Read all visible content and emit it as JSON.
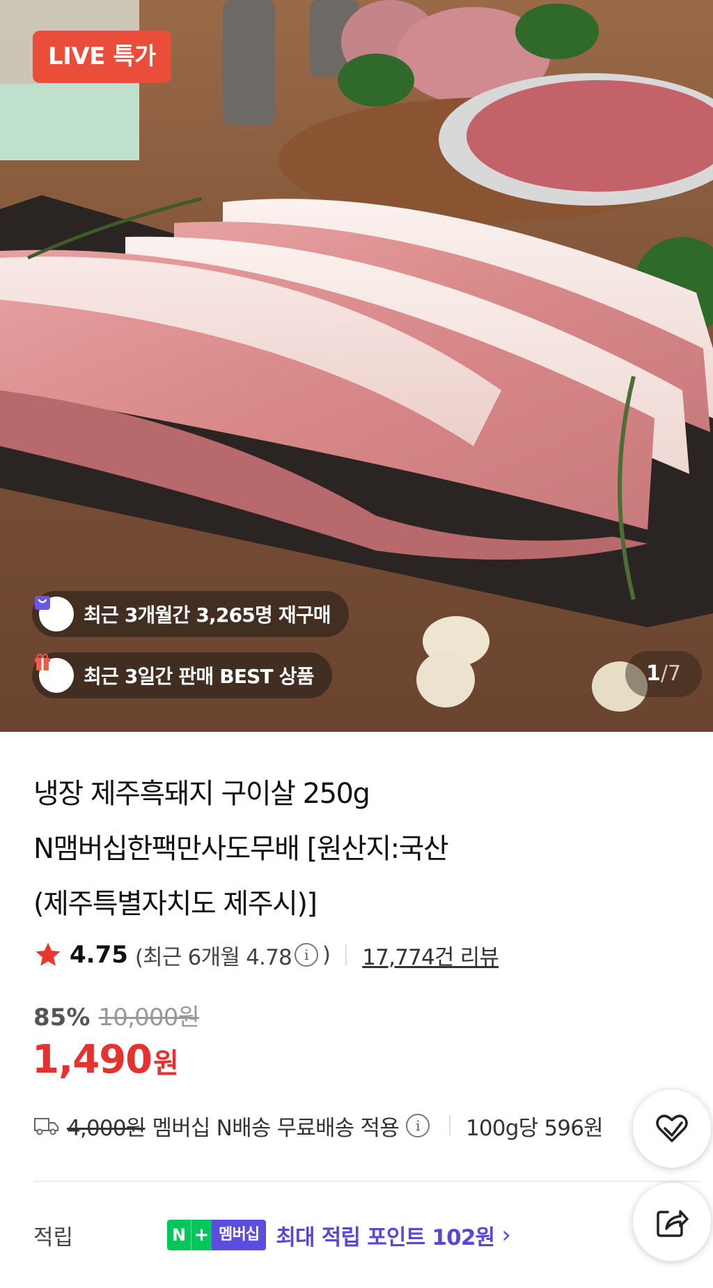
{
  "hero": {
    "live_badge": "LIVE 특가",
    "chips": [
      {
        "icon": "shopping-bag-icon",
        "text": "최근 3개월간 3,265명 재구매"
      },
      {
        "icon": "gift-box-icon",
        "text": "최근 3일간 판매 BEST 상품"
      }
    ],
    "pager": {
      "current": "1",
      "separator": "/",
      "total": "7"
    }
  },
  "product": {
    "title_lines": [
      "냉장 제주흑돼지 구이살 250g",
      "N맴버십한팩만사도무배 [원산지:국산",
      "(제주특별자치도 제주시)]"
    ]
  },
  "rating": {
    "score": "4.75",
    "recent_prefix": "(최근 6개월 4.78",
    "recent_suffix": ")",
    "info_glyph": "i",
    "reviews": "17,774건 리뷰"
  },
  "price": {
    "discount_rate": "85%",
    "original": "10,000원",
    "sale_number": "1,490",
    "sale_unit": "원"
  },
  "shipping": {
    "old_fee": "4,000원",
    "text": "멤버십 N배송 무료배송 적용",
    "info_glyph": "i",
    "per_unit": "100g당 596원"
  },
  "points": {
    "label": "적립",
    "badge_n": "N",
    "badge_plus": "+",
    "badge_member": "멤버십",
    "text": "최대 적립 포인트 102원",
    "chevron": "›"
  },
  "colors": {
    "live_badge": "#ea4e3a",
    "sale_price": "#e5322e",
    "points_text": "#5a46d8",
    "npay_green": "#03c75a",
    "membership_purple": "#5a4de0",
    "star": "#e8372b"
  }
}
